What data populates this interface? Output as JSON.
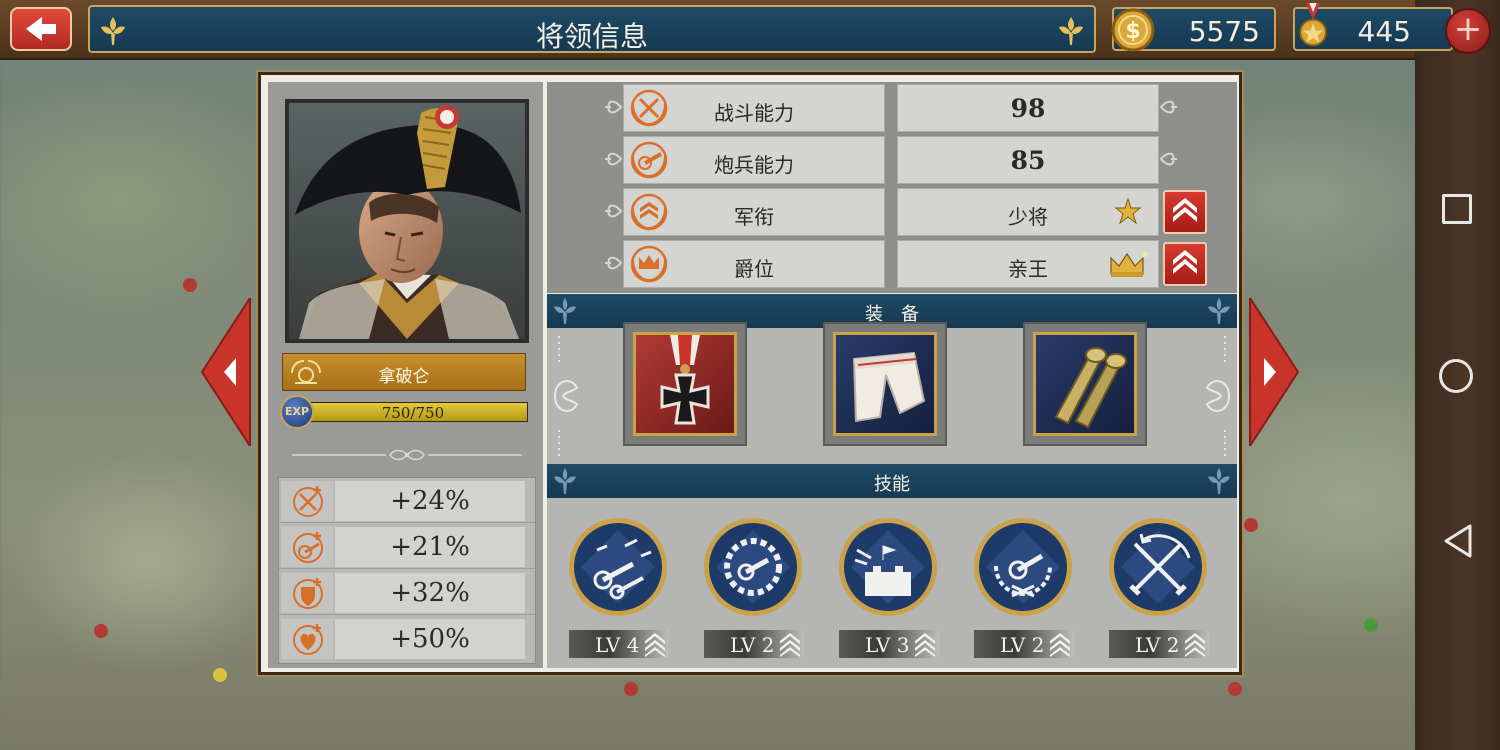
{
  "top_bar": {
    "title": "将领信息",
    "gold": "5575",
    "medals": "445",
    "plus": "+"
  },
  "general": {
    "name": "拿破仑",
    "exp_label": "EXP",
    "exp_text": "750/750",
    "exp_fraction": 1.0
  },
  "bonuses": [
    {
      "icon": "swords-plus-icon",
      "value": "+24%"
    },
    {
      "icon": "cannon-plus-icon",
      "value": "+21%"
    },
    {
      "icon": "shield-plus-icon",
      "value": "+32%"
    },
    {
      "icon": "heart-plus-icon",
      "value": "+50%"
    }
  ],
  "stats": [
    {
      "label": "战斗能力",
      "value": "98",
      "icon": "crossed-swords-icon"
    },
    {
      "label": "炮兵能力",
      "value": "85",
      "icon": "cannon-icon"
    },
    {
      "label": "军衔",
      "value": "少将",
      "icon": "rank-chevron-icon"
    },
    {
      "label": "爵位",
      "value": "亲王",
      "icon": "crown-icon"
    }
  ],
  "sections": {
    "equipment": "装　备",
    "skills": "技能"
  },
  "equipment": [
    {
      "name": "iron-cross-medal-icon"
    },
    {
      "name": "white-trousers-icon"
    },
    {
      "name": "epaulettes-icon"
    }
  ],
  "skills": [
    {
      "icon": "artillery-barrage-skill-icon",
      "level": "LV 4"
    },
    {
      "icon": "cannon-gear-skill-icon",
      "level": "LV 2"
    },
    {
      "icon": "fortress-attack-skill-icon",
      "level": "LV 3"
    },
    {
      "icon": "laurel-cannon-skill-icon",
      "level": "LV 2"
    },
    {
      "icon": "crossed-swords-skill-icon",
      "level": "LV 2"
    }
  ],
  "colors": {
    "header_blue": "#163a52",
    "gold_trim": "#c9a45a",
    "red_button": "#b32a22"
  }
}
